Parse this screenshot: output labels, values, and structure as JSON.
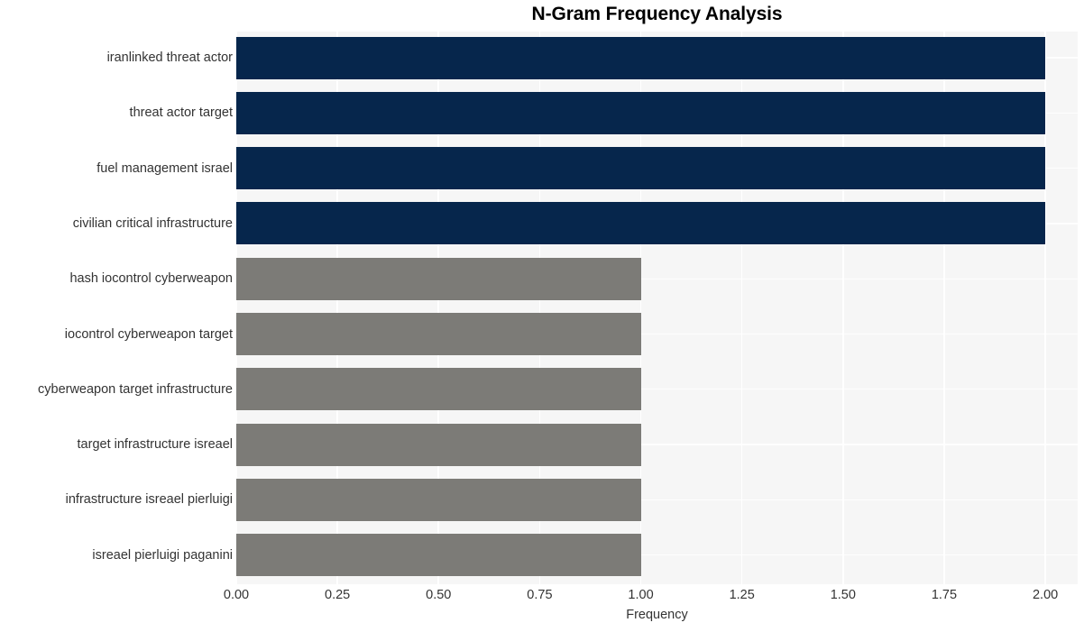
{
  "chart_data": {
    "type": "bar",
    "orientation": "horizontal",
    "title": "N-Gram Frequency Analysis",
    "xlabel": "Frequency",
    "ylabel": "",
    "xlim": [
      0,
      2.08
    ],
    "xticks": [
      "0.00",
      "0.25",
      "0.50",
      "0.75",
      "1.00",
      "1.25",
      "1.50",
      "1.75",
      "2.00"
    ],
    "xtick_values": [
      0,
      0.25,
      0.5,
      0.75,
      1.0,
      1.25,
      1.5,
      1.75,
      2.0
    ],
    "grid": true,
    "legend": "none",
    "categories": [
      "iranlinked threat actor",
      "threat actor target",
      "fuel management israel",
      "civilian critical infrastructure",
      "hash iocontrol cyberweapon",
      "iocontrol cyberweapon target",
      "cyberweapon target infrastructure",
      "target infrastructure isreael",
      "infrastructure isreael pierluigi",
      "isreael pierluigi paganini"
    ],
    "values": [
      2,
      2,
      2,
      2,
      1,
      1,
      1,
      1,
      1,
      1
    ],
    "bar_colors": [
      "#06264c",
      "#06264c",
      "#06264c",
      "#06264c",
      "#7c7b77",
      "#7c7b77",
      "#7c7b77",
      "#7c7b77",
      "#7c7b77",
      "#7c7b77"
    ],
    "colors": {
      "high": "#06264c",
      "low": "#7c7b77",
      "plot_background": "#f6f6f6",
      "figure_background": "#ffffff",
      "gridline": "#ffffff",
      "text": "#333333",
      "title_text": "#000000"
    }
  }
}
